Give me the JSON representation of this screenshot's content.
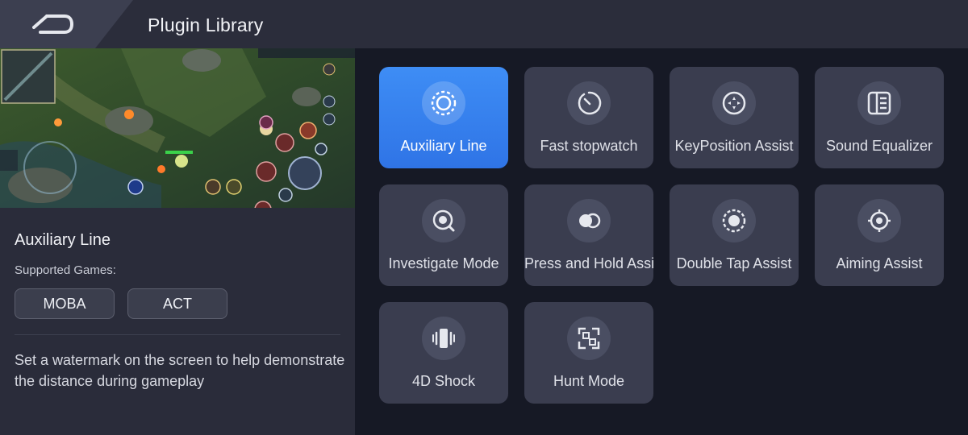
{
  "header": {
    "title": "Plugin Library",
    "back_icon": "back-arrow-icon"
  },
  "detail": {
    "preview_alt": "",
    "title": "Auxiliary Line",
    "supported_label": "Supported Games:",
    "tags": [
      "MOBA",
      "ACT"
    ],
    "description": "Set a watermark on the screen to help demonstrate the distance during gameplay"
  },
  "plugins": [
    {
      "label": "Auxiliary Line",
      "icon": "auxiliary-line-icon",
      "selected": true
    },
    {
      "label": "Fast stopwatch",
      "icon": "stopwatch-icon",
      "selected": false
    },
    {
      "label": "KeyPosition Assist",
      "icon": "key-position-icon",
      "selected": false
    },
    {
      "label": "Sound Equalizer",
      "icon": "equalizer-icon",
      "selected": false
    },
    {
      "label": "Investigate Mode",
      "icon": "investigate-icon",
      "selected": false
    },
    {
      "label": "Press and Hold Assist",
      "icon": "press-hold-icon",
      "selected": false
    },
    {
      "label": "Double Tap Assist",
      "icon": "double-tap-icon",
      "selected": false
    },
    {
      "label": "Aiming Assist",
      "icon": "crosshair-icon",
      "selected": false
    },
    {
      "label": "4D Shock",
      "icon": "vibration-icon",
      "selected": false
    },
    {
      "label": "Hunt Mode",
      "icon": "hunt-mode-icon",
      "selected": false
    }
  ],
  "colors": {
    "accent": "#3a86f0",
    "card": "#3a3d4f",
    "background": "#161925",
    "panel": "#2a2c3a"
  }
}
